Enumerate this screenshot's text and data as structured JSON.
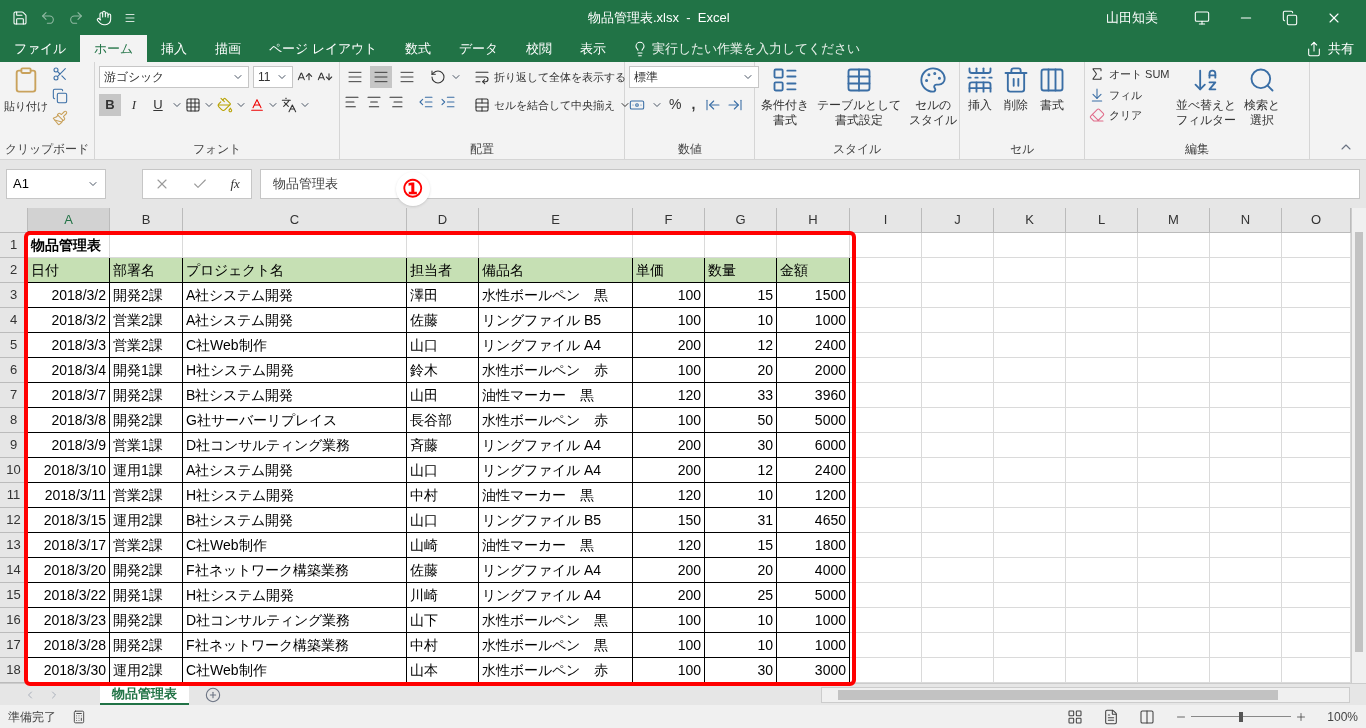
{
  "title_bar": {
    "title": "物品管理表.xlsx  -  Excel",
    "user": "山田知美"
  },
  "ribbon_tabs": [
    {
      "label": "ファイル",
      "selected": false
    },
    {
      "label": "ホーム",
      "selected": true
    },
    {
      "label": "挿入",
      "selected": false
    },
    {
      "label": "描画",
      "selected": false
    },
    {
      "label": "ページ レイアウト",
      "selected": false
    },
    {
      "label": "数式",
      "selected": false
    },
    {
      "label": "データ",
      "selected": false
    },
    {
      "label": "校閲",
      "selected": false
    },
    {
      "label": "表示",
      "selected": false
    }
  ],
  "tell_me": "実行したい作業を入力してください",
  "share": "共有",
  "ribbon": {
    "clipboard": {
      "paste": "貼り付け",
      "label": "クリップボード"
    },
    "font": {
      "font_name": "游ゴシック",
      "font_size": "11",
      "bold": "B",
      "bold_on": true,
      "italic": "I",
      "underline": "U",
      "label": "フォント"
    },
    "alignment": {
      "vertical": [
        {
          "selected": false
        },
        {
          "selected": true
        },
        {
          "selected": false
        }
      ],
      "wrap": "折り返して全体を表示する",
      "merge": "セルを結合して中央揃え",
      "label": "配置"
    },
    "number": {
      "format": "標準",
      "percent": "%",
      "comma": ",",
      "label": "数値"
    },
    "styles": {
      "buttons": [
        {
          "lines": [
            "条件付き",
            "書式"
          ]
        },
        {
          "lines": [
            "テーブルとして",
            "書式設定"
          ]
        },
        {
          "lines": [
            "セルの",
            "スタイル"
          ]
        }
      ],
      "label": "スタイル"
    },
    "cells": {
      "buttons": [
        "挿入",
        "削除",
        "書式"
      ],
      "label": "セル"
    },
    "editing": {
      "autosum": "オート SUM",
      "fill": "フィル",
      "clear": "クリア",
      "sort": [
        "並べ替えと",
        "フィルター"
      ],
      "find": [
        "検索と",
        "選択"
      ],
      "label": "編集"
    }
  },
  "formula_bar": {
    "name_box": "A1",
    "fx": "fx",
    "content": "物品管理表"
  },
  "callout": "①",
  "columns": [
    {
      "label": "A",
      "selected": true,
      "numeric": true
    },
    {
      "label": "B",
      "selected": false,
      "numeric": false
    },
    {
      "label": "C",
      "selected": false,
      "numeric": false
    },
    {
      "label": "D",
      "selected": false,
      "numeric": false
    },
    {
      "label": "E",
      "selected": false,
      "numeric": false
    },
    {
      "label": "F",
      "selected": false,
      "numeric": true
    },
    {
      "label": "G",
      "selected": false,
      "numeric": true
    },
    {
      "label": "H",
      "selected": false,
      "numeric": true
    },
    {
      "label": "I",
      "selected": false
    },
    {
      "label": "J",
      "selected": false
    },
    {
      "label": "K",
      "selected": false
    },
    {
      "label": "L",
      "selected": false
    },
    {
      "label": "M",
      "selected": false
    },
    {
      "label": "N",
      "selected": false
    },
    {
      "label": "O",
      "selected": false
    }
  ],
  "rows": [
    {
      "number": "1",
      "kind": "title",
      "cells": [
        "物品管理表"
      ]
    },
    {
      "number": "2",
      "kind": "header",
      "cells": [
        "日付",
        "部署名",
        "プロジェクト名",
        "担当者",
        "備品名",
        "単価",
        "数量",
        "金額"
      ]
    },
    {
      "number": "3",
      "kind": "data",
      "cells": [
        "2018/3/2",
        "開発2課",
        "A社システム開発",
        "澤田",
        "水性ボールペン　黒",
        "100",
        "15",
        "1500"
      ]
    },
    {
      "number": "4",
      "kind": "data",
      "cells": [
        "2018/3/2",
        "営業2課",
        "A社システム開発",
        "佐藤",
        "リングファイル B5",
        "100",
        "10",
        "1000"
      ]
    },
    {
      "number": "5",
      "kind": "data",
      "cells": [
        "2018/3/3",
        "営業2課",
        "C社Web制作",
        "山口",
        "リングファイル A4",
        "200",
        "12",
        "2400"
      ]
    },
    {
      "number": "6",
      "kind": "data",
      "cells": [
        "2018/3/4",
        "開発1課",
        "H社システム開発",
        "鈴木",
        "水性ボールペン　赤",
        "100",
        "20",
        "2000"
      ]
    },
    {
      "number": "7",
      "kind": "data",
      "cells": [
        "2018/3/7",
        "開発2課",
        "B社システム開発",
        "山田",
        "油性マーカー　黒",
        "120",
        "33",
        "3960"
      ]
    },
    {
      "number": "8",
      "kind": "data",
      "cells": [
        "2018/3/8",
        "開発2課",
        "G社サーバーリプレイス",
        "長谷部",
        "水性ボールペン　赤",
        "100",
        "50",
        "5000"
      ]
    },
    {
      "number": "9",
      "kind": "data",
      "cells": [
        "2018/3/9",
        "営業1課",
        "D社コンサルティング業務",
        "斉藤",
        "リングファイル A4",
        "200",
        "30",
        "6000"
      ]
    },
    {
      "number": "10",
      "kind": "data",
      "cells": [
        "2018/3/10",
        "運用1課",
        "A社システム開発",
        "山口",
        "リングファイル A4",
        "200",
        "12",
        "2400"
      ]
    },
    {
      "number": "11",
      "kind": "data",
      "cells": [
        "2018/3/11",
        "営業2課",
        "H社システム開発",
        "中村",
        "油性マーカー　黒",
        "120",
        "10",
        "1200"
      ]
    },
    {
      "number": "12",
      "kind": "data",
      "cells": [
        "2018/3/15",
        "運用2課",
        "B社システム開発",
        "山口",
        "リングファイル B5",
        "150",
        "31",
        "4650"
      ]
    },
    {
      "number": "13",
      "kind": "data",
      "cells": [
        "2018/3/17",
        "営業2課",
        "C社Web制作",
        "山崎",
        "油性マーカー　黒",
        "120",
        "15",
        "1800"
      ]
    },
    {
      "number": "14",
      "kind": "data",
      "cells": [
        "2018/3/20",
        "開発2課",
        "F社ネットワーク構築業務",
        "佐藤",
        "リングファイル A4",
        "200",
        "20",
        "4000"
      ]
    },
    {
      "number": "15",
      "kind": "data",
      "cells": [
        "2018/3/22",
        "開発1課",
        "H社システム開発",
        "川崎",
        "リングファイル A4",
        "200",
        "25",
        "5000"
      ]
    },
    {
      "number": "16",
      "kind": "data",
      "cells": [
        "2018/3/23",
        "開発2課",
        "D社コンサルティング業務",
        "山下",
        "水性ボールペン　黒",
        "100",
        "10",
        "1000"
      ]
    },
    {
      "number": "17",
      "kind": "data",
      "cells": [
        "2018/3/28",
        "開発2課",
        "F社ネットワーク構築業務",
        "中村",
        "水性ボールペン　黒",
        "100",
        "10",
        "1000"
      ]
    },
    {
      "number": "18",
      "kind": "data",
      "cells": [
        "2018/3/30",
        "運用2課",
        "C社Web制作",
        "山本",
        "水性ボールペン　赤",
        "100",
        "30",
        "3000"
      ]
    }
  ],
  "sheet_tabs": [
    {
      "label": "物品管理表",
      "selected": true
    }
  ],
  "status_bar": {
    "status": "準備完了",
    "zoom": "100%",
    "zoom_slider": {
      "level": 0.5
    }
  }
}
